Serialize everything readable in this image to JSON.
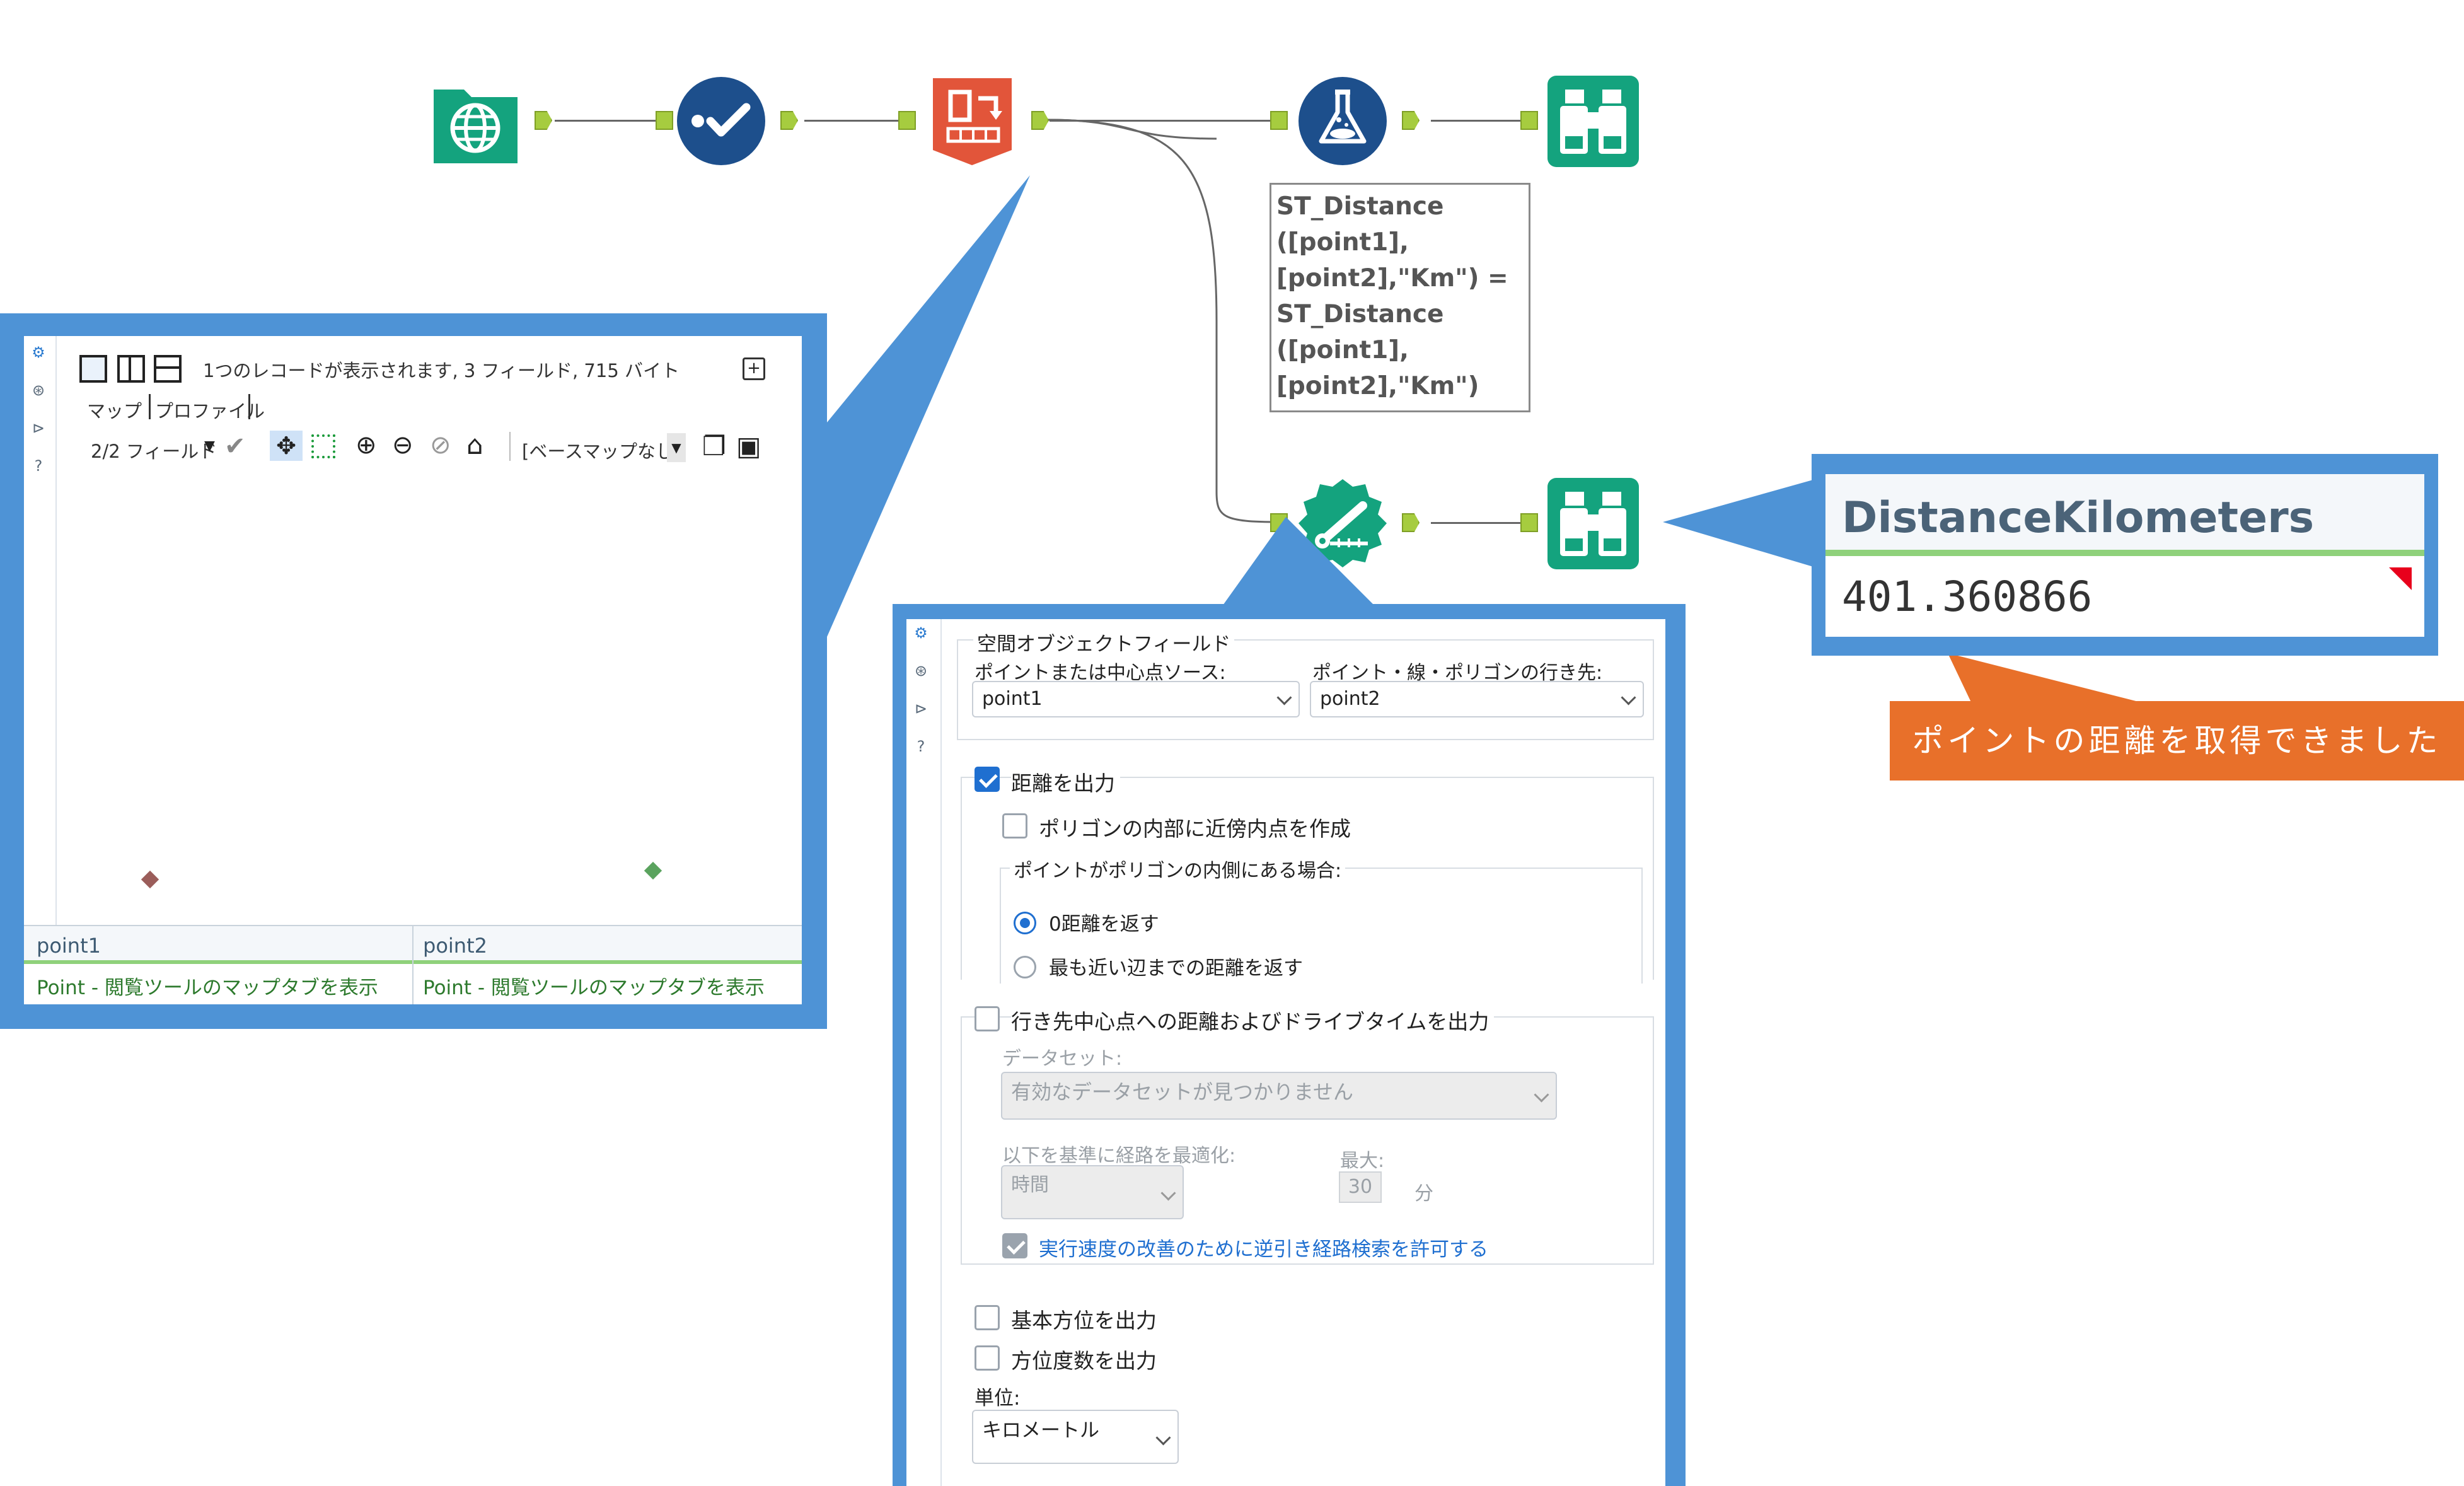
{
  "annotation": {
    "formula_lines": [
      "ST_Distance",
      "([point1],",
      "[point2],\"Km\") =",
      "ST_Distance",
      "([point1],",
      "[point2],\"Km\")"
    ],
    "result_callout": "ポイントの距離を取得できました"
  },
  "result_grid": {
    "column": "DistanceKilometers",
    "value": "401.360866"
  },
  "browse_panel": {
    "status": "1つのレコードが表示されます, 3 フィールド, 715 バイト",
    "tabs": [
      "マップ",
      "プロファイル"
    ],
    "field_selector": "2/2 フィールド",
    "basemap": "[ベースマップなし]",
    "columns": [
      "point1",
      "point2"
    ],
    "row": [
      "Point - 閲覧ツールのマップタブを表示",
      "Point - 閲覧ツールのマップタブを表示"
    ]
  },
  "config_panel": {
    "section_title": "空間オブジェクトフィールド",
    "source_label": "ポイントまたは中心点ソース:",
    "source_value": "point1",
    "dest_label": "ポイント・線・ポリゴンの行き先:",
    "dest_value": "point2",
    "output_distance": "距離を出力",
    "output_distance_checked": true,
    "polygon_option": "ポリゴンの内部に近傍内点を作成",
    "inside_label": "ポイントがポリゴンの内側にある場合:",
    "radio_zero": "0距離を返す",
    "radio_nearest": "最も近い辺までの距離を返す",
    "drive_time": "行き先中心点への距離およびドライブタイムを出力",
    "dataset_label": "データセット:",
    "dataset_value": "有効なデータセットが見つかりません",
    "optimize_label": "以下を基準に経路を最適化:",
    "optimize_value": "時間",
    "max_label": "最大:",
    "max_value": "30",
    "max_unit": "分",
    "reverse_search": "実行速度の改善のために逆引き経路検索を許可する",
    "cardinal": "基本方位を出力",
    "degrees": "方位度数を出力",
    "unit_label": "単位:",
    "unit_value": "キロメートル"
  }
}
